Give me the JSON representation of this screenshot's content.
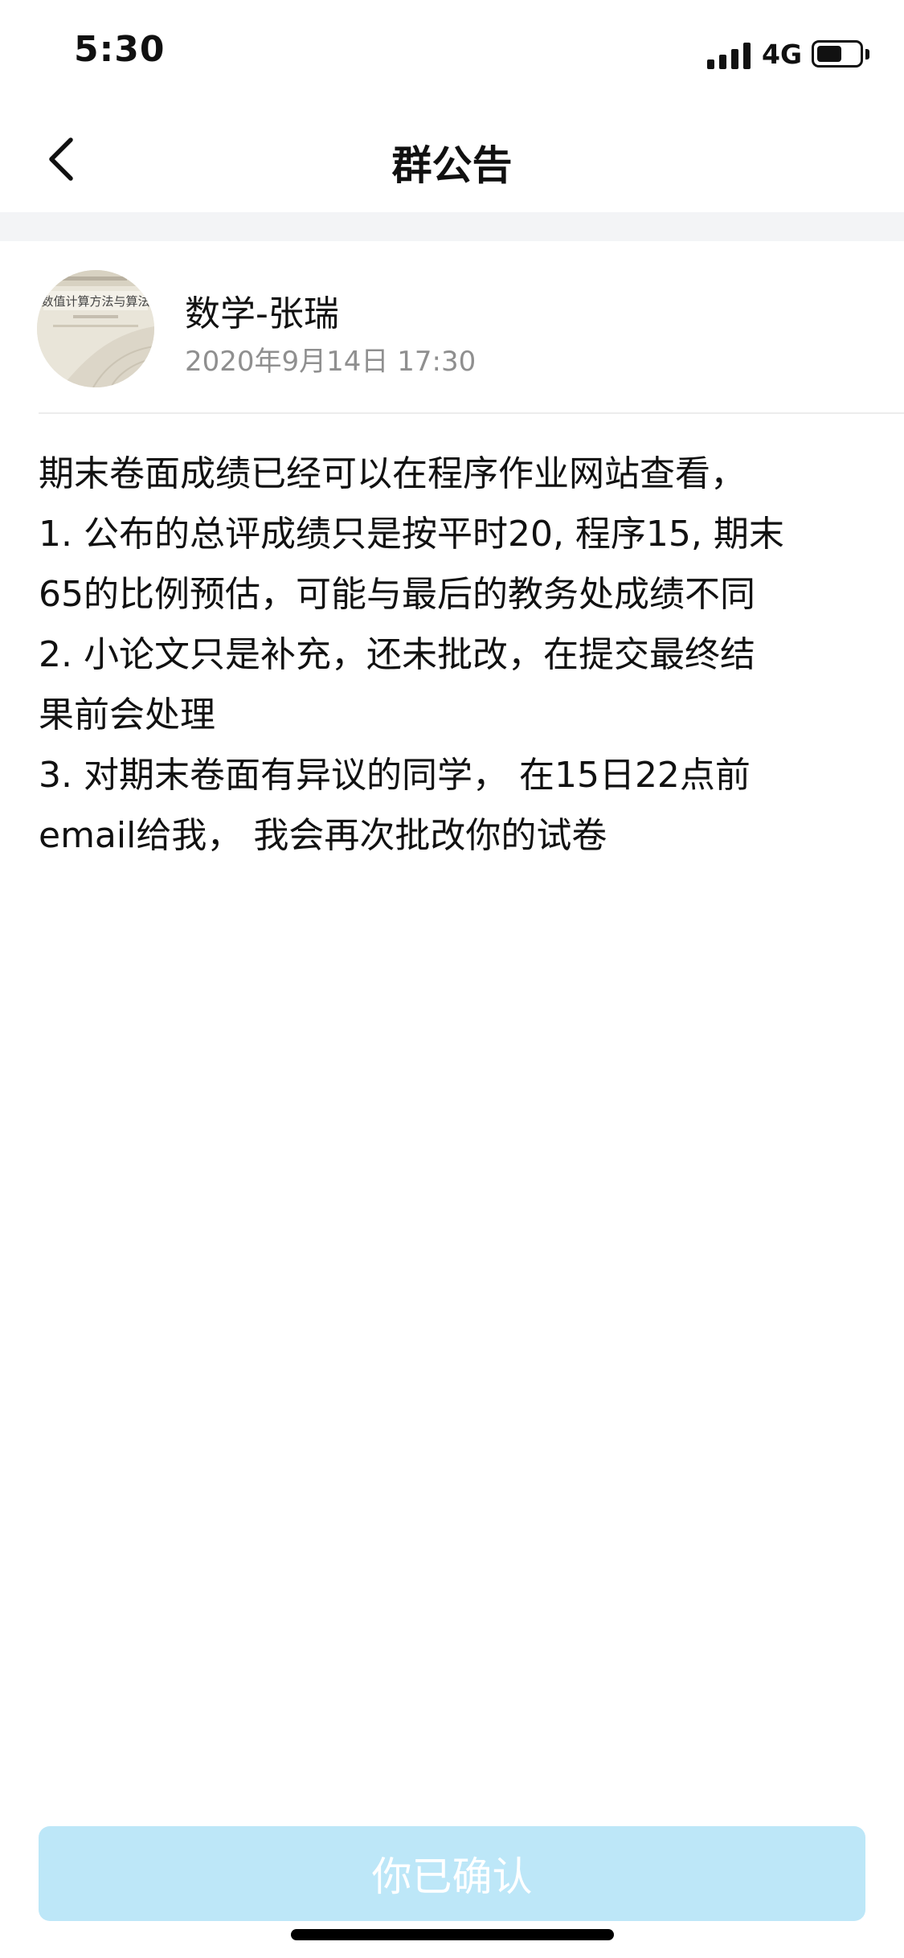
{
  "status_bar": {
    "time": "5:30",
    "network": "4G",
    "battery_level": 0.6,
    "icons": [
      "signal-icon",
      "battery-icon"
    ]
  },
  "nav": {
    "title": "群公告",
    "back_icon": "chevron-left-icon"
  },
  "author": {
    "name": "数学-张瑞",
    "time": "2020年9月14日 17:30",
    "avatar_book_title": "数值计算方法与算法"
  },
  "announcement": {
    "lines": [
      "期末卷面成绩已经可以在程序作业网站查看，",
      "1. 公布的总评成绩只是按平时20, 程序15, 期末",
      "65的比例预估，可能与最后的教务处成绩不同",
      "2. 小论文只是补充，还未批改，在提交最终结",
      "果前会处理",
      "3. 对期末卷面有异议的同学， 在15日22点前",
      "email给我， 我会再次批改你的试卷"
    ]
  },
  "footer": {
    "confirm_label": "你已确认",
    "confirm_color": "#bde7f8"
  }
}
